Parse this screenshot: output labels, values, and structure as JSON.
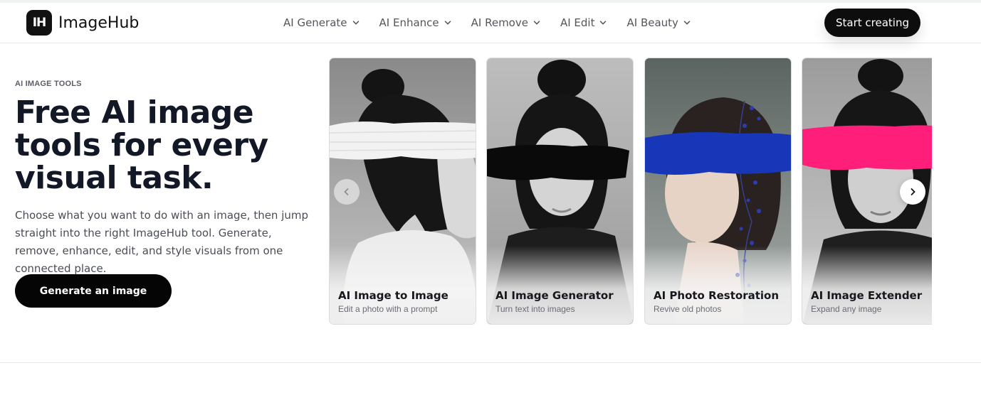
{
  "brand": {
    "name": "ImageHub",
    "mark": "IH"
  },
  "nav": {
    "items": [
      {
        "label": "AI Generate"
      },
      {
        "label": "AI Enhance"
      },
      {
        "label": "AI Remove"
      },
      {
        "label": "AI Edit"
      },
      {
        "label": "AI Beauty"
      }
    ],
    "cta_label": "Start creating"
  },
  "hero": {
    "eyebrow": "AI IMAGE TOOLS",
    "headline_lines": [
      "Free AI image",
      "tools for every",
      "visual task."
    ],
    "description": "Choose what you want to do with an image, then jump straight into the right ImageHub tool. Generate, remove, enhance, edit, and style visuals from one connected place.",
    "cta_label": "Generate an image"
  },
  "carousel": {
    "cards": [
      {
        "title": "AI Image to Image",
        "subtitle": "Edit a photo with a prompt",
        "stroke_color": "#f2f2f2"
      },
      {
        "title": "AI Image Generator",
        "subtitle": "Turn text into images",
        "stroke_color": "#0a0a0a"
      },
      {
        "title": "AI Photo Restoration",
        "subtitle": "Revive old photos",
        "stroke_color": "#1737b8"
      },
      {
        "title": "AI Image Extender",
        "subtitle": "Expand any image",
        "stroke_color": "#ff1f7a"
      }
    ]
  },
  "icons": {
    "nav_caret": "chevron-down-icon",
    "prev": "chevron-left-icon",
    "next": "chevron-right-icon"
  }
}
